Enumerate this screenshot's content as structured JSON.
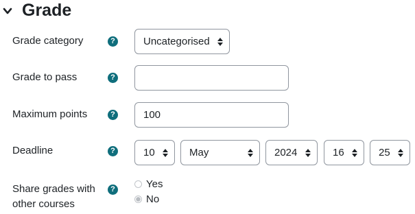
{
  "section": {
    "title": "Grade"
  },
  "fields": {
    "category": {
      "label": "Grade category",
      "value": "Uncategorised"
    },
    "pass": {
      "label": "Grade to pass",
      "value": ""
    },
    "maxpoints": {
      "label": "Maximum points",
      "value": "100"
    },
    "deadline": {
      "label": "Deadline",
      "day": "10",
      "month": "May",
      "year": "2024",
      "hour": "16",
      "minute": "25"
    },
    "share": {
      "label_line1": "Share grades with",
      "label_line2": "other courses",
      "options": [
        "Yes",
        "No"
      ],
      "selected": "No"
    }
  },
  "icons": {
    "collapse": "chevron-down-icon",
    "help": "question-mark-icon",
    "select": "up-down-arrows-icon"
  },
  "colors": {
    "help_icon": "#0f6e7c",
    "border": "#8f959e",
    "text": "#1d2125"
  }
}
